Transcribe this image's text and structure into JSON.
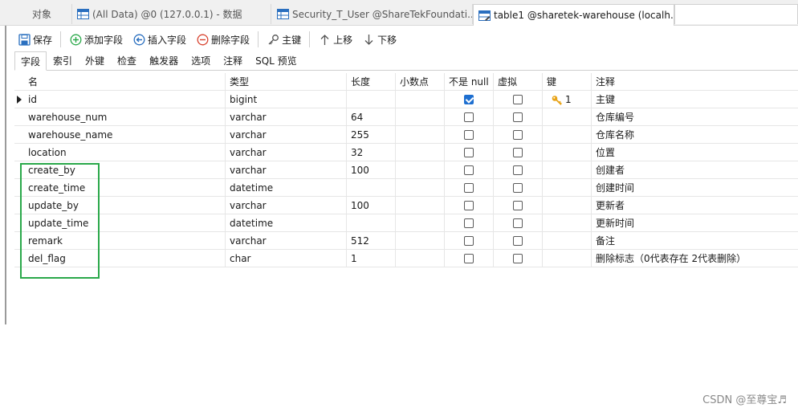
{
  "doc_tabs": [
    {
      "label": "对象",
      "active": false
    },
    {
      "label": "(All Data) @0 (127.0.0.1) - 数据",
      "active": false
    },
    {
      "label": "Security_T_User @ShareTekFoundati...",
      "active": false
    },
    {
      "label": "table1 @sharetek-warehouse (localh...",
      "active": true
    }
  ],
  "toolbar": {
    "save": "保存",
    "add_field": "添加字段",
    "insert_field": "插入字段",
    "delete_field": "删除字段",
    "primary_key": "主键",
    "move_up": "上移",
    "move_down": "下移"
  },
  "sub_tabs": [
    "字段",
    "索引",
    "外键",
    "检查",
    "触发器",
    "选项",
    "注释",
    "SQL 预览"
  ],
  "columns": {
    "name": "名",
    "type": "类型",
    "length": "长度",
    "decimals": "小数点",
    "not_null": "不是 null",
    "virtual": "虚拟",
    "key": "键",
    "comment": "注释"
  },
  "rows": [
    {
      "name": "id",
      "type": "bigint",
      "length": "",
      "decimals": "",
      "not_null": true,
      "virtual": false,
      "key": "1",
      "comment": "主键"
    },
    {
      "name": "warehouse_num",
      "type": "varchar",
      "length": "64",
      "decimals": "",
      "not_null": false,
      "virtual": false,
      "key": "",
      "comment": "仓库编号"
    },
    {
      "name": "warehouse_name",
      "type": "varchar",
      "length": "255",
      "decimals": "",
      "not_null": false,
      "virtual": false,
      "key": "",
      "comment": "仓库名称"
    },
    {
      "name": "location",
      "type": "varchar",
      "length": "32",
      "decimals": "",
      "not_null": false,
      "virtual": false,
      "key": "",
      "comment": "位置"
    },
    {
      "name": "create_by",
      "type": "varchar",
      "length": "100",
      "decimals": "",
      "not_null": false,
      "virtual": false,
      "key": "",
      "comment": "创建者"
    },
    {
      "name": "create_time",
      "type": "datetime",
      "length": "",
      "decimals": "",
      "not_null": false,
      "virtual": false,
      "key": "",
      "comment": "创建时间"
    },
    {
      "name": "update_by",
      "type": "varchar",
      "length": "100",
      "decimals": "",
      "not_null": false,
      "virtual": false,
      "key": "",
      "comment": "更新者"
    },
    {
      "name": "update_time",
      "type": "datetime",
      "length": "",
      "decimals": "",
      "not_null": false,
      "virtual": false,
      "key": "",
      "comment": "更新时间"
    },
    {
      "name": "remark",
      "type": "varchar",
      "length": "512",
      "decimals": "",
      "not_null": false,
      "virtual": false,
      "key": "",
      "comment": "备注"
    },
    {
      "name": "del_flag",
      "type": "char",
      "length": "1",
      "decimals": "",
      "not_null": false,
      "virtual": false,
      "key": "",
      "comment": "删除标志（0代表存在 2代表删除）"
    }
  ],
  "watermark": "CSDN @至尊宝♬",
  "colors": {
    "accent": "#1e6fd0",
    "highlight": "#2aa84a",
    "key": "#e8a317"
  },
  "icons": [
    "table-icon",
    "save-icon",
    "plus-circle-icon",
    "insert-arrow-icon",
    "minus-circle-icon",
    "key-icon",
    "arrow-up-icon",
    "arrow-down-icon"
  ]
}
